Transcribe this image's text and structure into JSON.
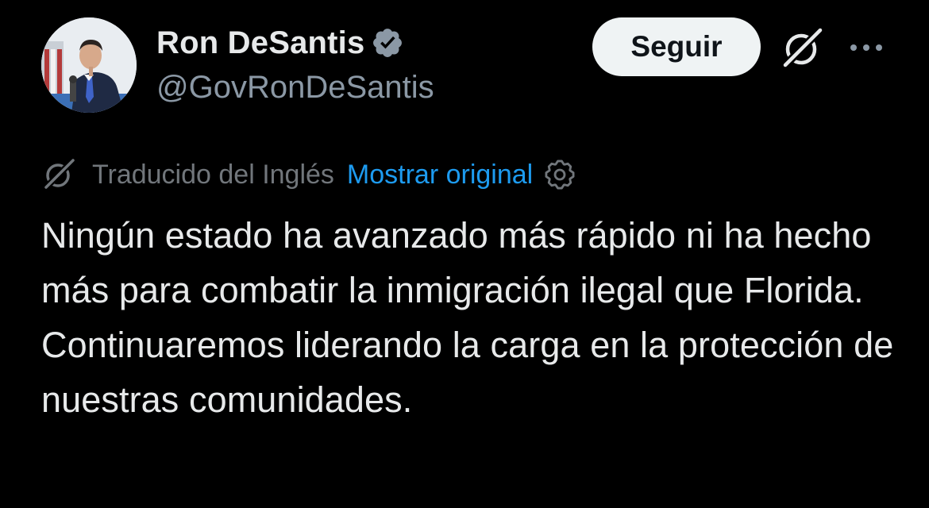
{
  "author": {
    "display_name": "Ron DeSantis",
    "handle": "@GovRonDeSantis",
    "verified": true,
    "avatar": "portrait-photo"
  },
  "actions": {
    "follow_label": "Seguir",
    "grok_icon": "grok-icon",
    "more_icon": "more-dots-icon"
  },
  "translation": {
    "label": "Traducido del Inglés",
    "show_original": "Mostrar original",
    "settings_icon": "gear-icon"
  },
  "tweet": {
    "text": "Ningún estado ha avanzado más rápido ni ha hecho más para combatir la inmigración ilegal que Florida. Continuaremos liderando la carga en la protección de nuestras comunidades."
  },
  "colors": {
    "background": "#000000",
    "text_primary": "#e7e9ea",
    "text_secondary": "#71767b",
    "link": "#1d9bf0",
    "verified_badge": "#8b98a5",
    "button_bg": "#eff3f4"
  }
}
